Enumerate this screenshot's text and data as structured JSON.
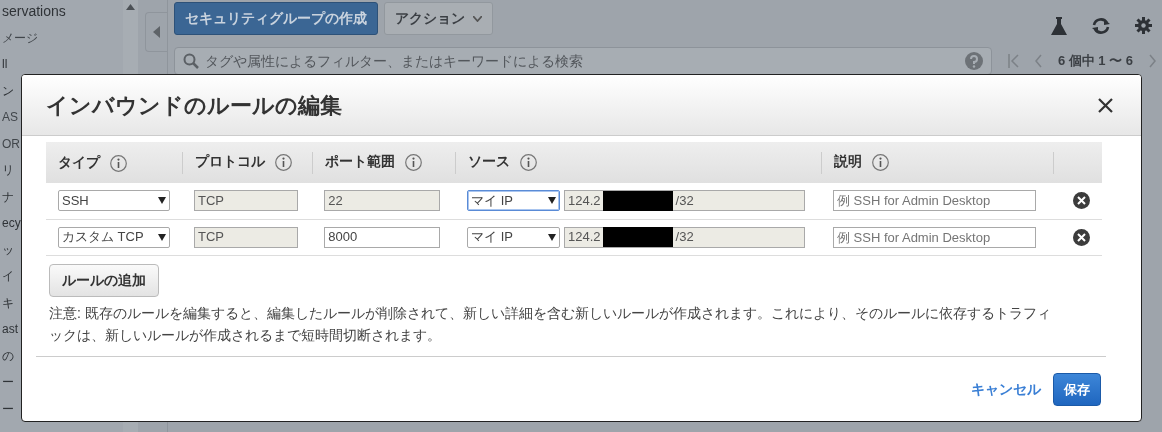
{
  "console": {
    "sidebar_items": [
      "servations",
      "メージ",
      "ll",
      "ン",
      "AS",
      "OR",
      "リ",
      "ナ",
      "ecy",
      "ッ",
      "イ",
      "キ",
      "ast",
      "の",
      "ー",
      "ー"
    ],
    "create_button": "セキュリティグループの作成",
    "actions_button": "アクション",
    "search": {
      "placeholder": "タグや属性によるフィルター、またはキーワードによる検索"
    },
    "pagination": "6 個中 1 〜 6"
  },
  "dialog": {
    "title": "インバウンドのルールの編集",
    "columns": [
      "タイプ",
      "プロトコル",
      "ポート範囲",
      "ソース",
      "説明"
    ],
    "rules": [
      {
        "type": "SSH",
        "protocol": "TCP",
        "port": "22",
        "port_editable": false,
        "source": "マイ IP",
        "source_focused": true,
        "cidr_start": "124.2",
        "cidr_end": "/32",
        "description_placeholder": "例 SSH for Admin Desktop"
      },
      {
        "type": "カスタム TCP",
        "protocol": "TCP",
        "port": "8000",
        "port_editable": true,
        "source": "マイ IP",
        "source_focused": false,
        "cidr_start": "124.2",
        "cidr_end": "/32",
        "description_placeholder": "例 SSH for Admin Desktop"
      }
    ],
    "add_button": "ルールの追加",
    "note": "注意: 既存のルールを編集すると、編集したルールが削除されて、新しい詳細を含む新しいルールが作成されます。これにより、そのルールに依存するトラフィックは、新しいルールが作成されるまで短時間切断されます。",
    "cancel": "キャンセル",
    "save": "保存"
  }
}
